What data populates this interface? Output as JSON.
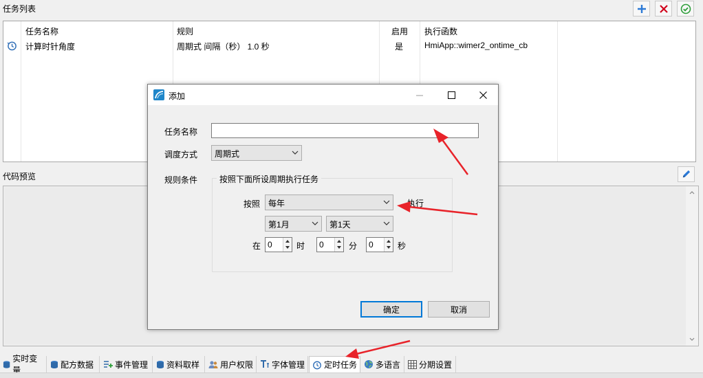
{
  "task_list": {
    "title": "任务列表",
    "columns": [
      "任务名称",
      "规则",
      "启用",
      "执行函数"
    ],
    "rows": [
      {
        "name": "计算时针角度",
        "rule": "周期式 间隔（秒） 1.0 秒",
        "enabled": "是",
        "function": "HmiApp::wimer2_ontime_cb"
      }
    ]
  },
  "code_preview": {
    "title": "代码预览"
  },
  "tabs": [
    {
      "label": "实时变量",
      "icon": "database-icon"
    },
    {
      "label": "配方数据",
      "icon": "database-icon"
    },
    {
      "label": "事件管理",
      "icon": "list-add-icon"
    },
    {
      "label": "资料取样",
      "icon": "database-icon"
    },
    {
      "label": "用户权限",
      "icon": "users-icon"
    },
    {
      "label": "字体管理",
      "icon": "font-icon"
    },
    {
      "label": "定时任务",
      "icon": "clock-icon"
    },
    {
      "label": "多语言",
      "icon": "globe-icon"
    },
    {
      "label": "分期设置",
      "icon": "table-icon"
    }
  ],
  "active_tab": "定时任务",
  "dialog": {
    "title": "添加",
    "task_name_label": "任务名称",
    "task_name_value": "",
    "schedule_label": "调度方式",
    "schedule_value": "周期式",
    "rule_label": "规则条件",
    "group_title": "按照下面所设周期执行任务",
    "by_label": "按照",
    "by_value": "每年",
    "execute_label": "执行",
    "month_value": "第1月",
    "day_value": "第1天",
    "at_label": "在",
    "hour_value": "0",
    "hour_label": "时",
    "minute_value": "0",
    "minute_label": "分",
    "second_value": "0",
    "second_label": "秒",
    "ok_label": "确定",
    "cancel_label": "取消"
  },
  "colors": {
    "accent": "#0078d7",
    "arrow": "#e8232a",
    "add": "#2b79d6",
    "delete": "#d0021b",
    "confirm": "#2e9e3a"
  }
}
